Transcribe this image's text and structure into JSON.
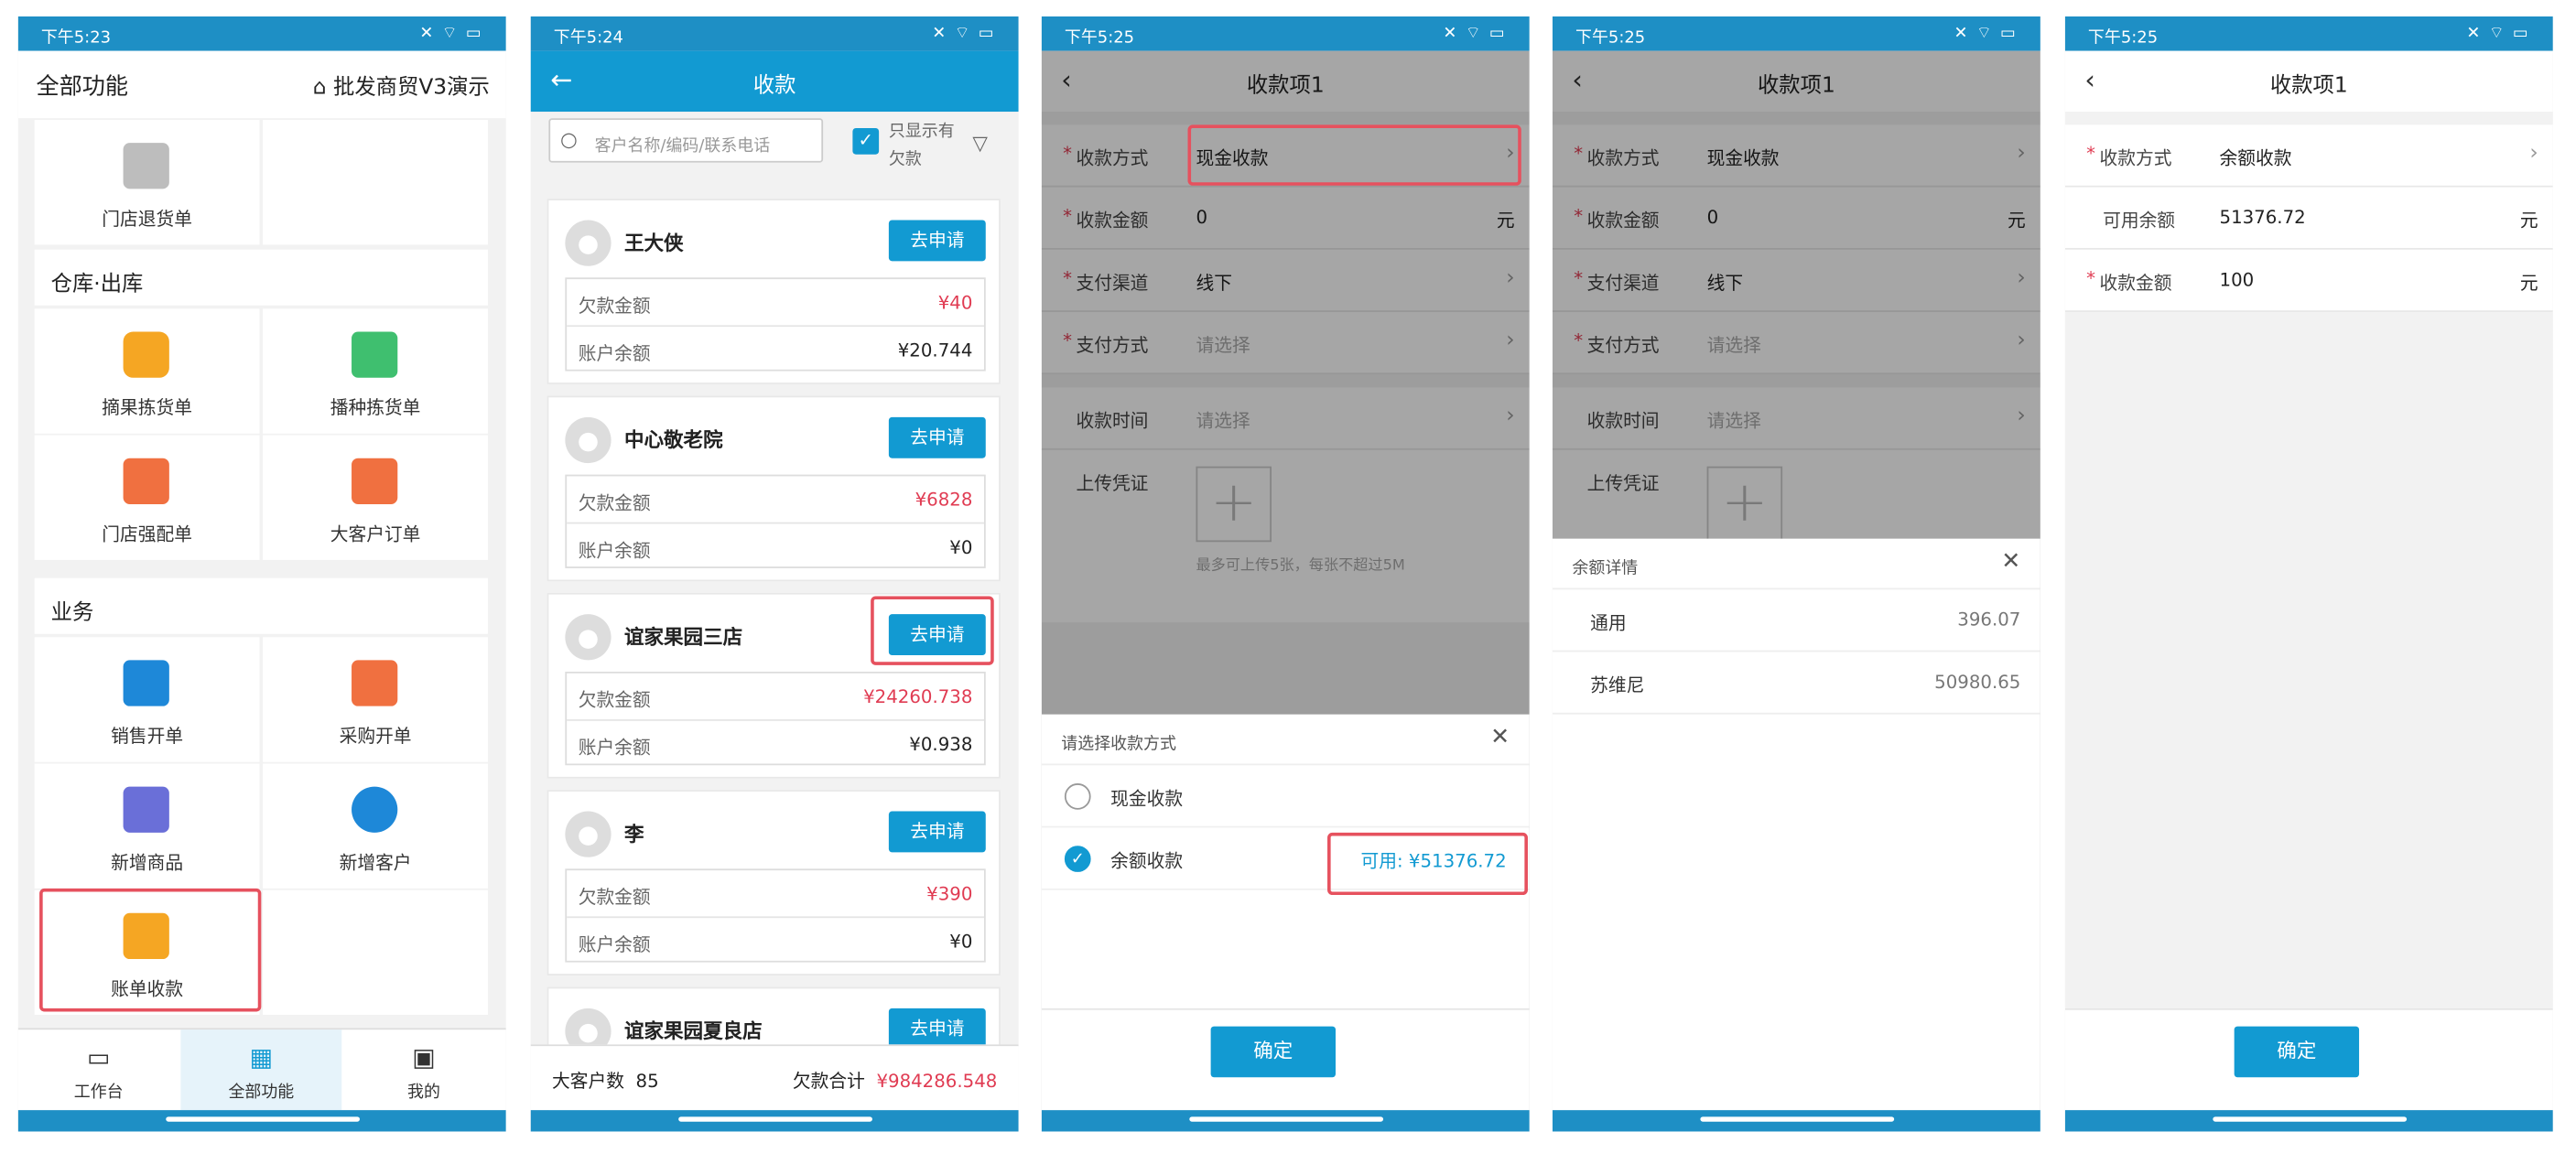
{
  "status": {
    "p1_time": "下午5:23",
    "p2_time": "下午5:24",
    "p3_time": "下午5:25",
    "p4_time": "下午5:25",
    "p5_time": "下午5:25",
    "right_icons": "✕ ⌔ ▭"
  },
  "phone1": {
    "header_left": "全部功能",
    "header_right": "批发商贸V3演示",
    "top_item": "门店退货单",
    "section_warehouse": "仓库·出库",
    "warehouse_items": [
      "摘果拣货单",
      "播种拣货单",
      "门店强配单",
      "大客户订单"
    ],
    "section_business": "业务",
    "business_items": [
      "销售开单",
      "采购开单",
      "新增商品",
      "新增客户",
      "账单收款"
    ],
    "tabs": [
      "工作台",
      "全部功能",
      "我的"
    ]
  },
  "phone2": {
    "title": "收款",
    "search_placeholder": "客户名称/编码/联系电话",
    "filter_label": "只显示有欠款",
    "apply_label": "去申请",
    "debt_label": "欠款金额",
    "balance_label": "账户余额",
    "customers": [
      {
        "name": "王大侠",
        "debt": "¥40",
        "balance": "¥20.744"
      },
      {
        "name": "中心敬老院",
        "debt": "¥6828",
        "balance": "¥0"
      },
      {
        "name": "谊家果园三店",
        "debt": "¥24260.738",
        "balance": "¥0.938"
      },
      {
        "name": "李",
        "debt": "¥390",
        "balance": "¥0"
      },
      {
        "name": "谊家果园夏良店"
      }
    ],
    "footer_count_label": "大客户数",
    "footer_count": "85",
    "footer_debt_label": "欠款合计",
    "footer_debt": "¥984286.548"
  },
  "form": {
    "title": "收款项1",
    "method_label": "收款方式",
    "amount_label": "收款金额",
    "channel_label": "支付渠道",
    "paytype_label": "支付方式",
    "time_label": "收款时间",
    "upload_label": "上传凭证",
    "method_value": "现金收款",
    "amount_value": "0",
    "unit": "元",
    "channel_value": "线下",
    "placeholder": "请选择",
    "upload_hint": "最多可上传5张，每张不超过5M"
  },
  "phone3": {
    "sheet_title": "请选择收款方式",
    "options": [
      "现金收款",
      "余额收款"
    ],
    "available": "可用: ¥51376.72",
    "ok": "确定"
  },
  "phone4": {
    "sheet_title": "余额详情",
    "rows": [
      {
        "name": "通用",
        "value": "396.07"
      },
      {
        "name": "苏维尼",
        "value": "50980.65"
      }
    ]
  },
  "phone5": {
    "method_value": "余额收款",
    "available_label": "可用余额",
    "available_value": "51376.72",
    "amount_value": "100",
    "ok": "确定"
  },
  "colors": {
    "accent": "#129ad2",
    "statusbar": "#1e8fc5",
    "red": "#e03b52",
    "highlight": "#e6515e"
  }
}
